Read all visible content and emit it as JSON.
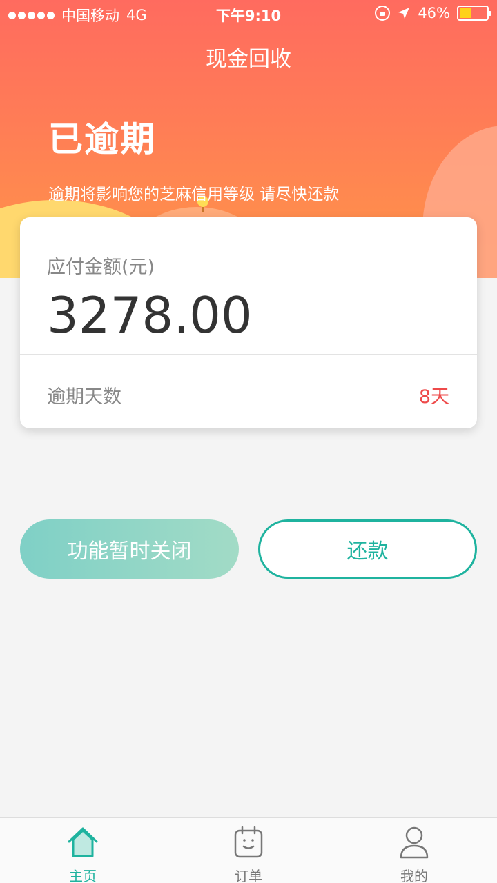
{
  "status_bar": {
    "carrier": "中国移动",
    "network": "4G",
    "time": "下午9:10",
    "battery": "46%",
    "battery_level": 0.46
  },
  "nav": {
    "title": "现金回收"
  },
  "hero": {
    "status": "已逾期",
    "note": "逾期将影响您的芝麻信用等级 请尽快还款"
  },
  "card": {
    "amount_label": "应付金额(元)",
    "amount_value": "3278.00",
    "overdue_days_label": "逾期天数",
    "overdue_days_value": "8天"
  },
  "actions": {
    "disabled_label": "功能暂时关闭",
    "repay_label": "还款"
  },
  "tabs": [
    {
      "label": "主页",
      "icon": "home-icon",
      "active": true
    },
    {
      "label": "订单",
      "icon": "order-icon",
      "active": false
    },
    {
      "label": "我的",
      "icon": "profile-icon",
      "active": false
    }
  ],
  "colors": {
    "accent": "#1fb39f",
    "header_top": "#ff6b5f",
    "header_bottom": "#ff9648",
    "overdue_red": "#ee4a4a"
  }
}
